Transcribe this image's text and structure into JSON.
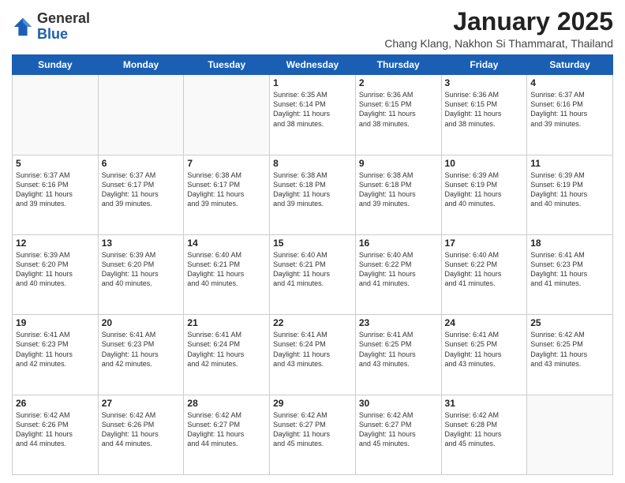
{
  "logo": {
    "general": "General",
    "blue": "Blue"
  },
  "title": "January 2025",
  "subtitle": "Chang Klang, Nakhon Si Thammarat, Thailand",
  "weekdays": [
    "Sunday",
    "Monday",
    "Tuesday",
    "Wednesday",
    "Thursday",
    "Friday",
    "Saturday"
  ],
  "weeks": [
    [
      {
        "day": "",
        "info": ""
      },
      {
        "day": "",
        "info": ""
      },
      {
        "day": "",
        "info": ""
      },
      {
        "day": "1",
        "info": "Sunrise: 6:35 AM\nSunset: 6:14 PM\nDaylight: 11 hours\nand 38 minutes."
      },
      {
        "day": "2",
        "info": "Sunrise: 6:36 AM\nSunset: 6:15 PM\nDaylight: 11 hours\nand 38 minutes."
      },
      {
        "day": "3",
        "info": "Sunrise: 6:36 AM\nSunset: 6:15 PM\nDaylight: 11 hours\nand 38 minutes."
      },
      {
        "day": "4",
        "info": "Sunrise: 6:37 AM\nSunset: 6:16 PM\nDaylight: 11 hours\nand 39 minutes."
      }
    ],
    [
      {
        "day": "5",
        "info": "Sunrise: 6:37 AM\nSunset: 6:16 PM\nDaylight: 11 hours\nand 39 minutes."
      },
      {
        "day": "6",
        "info": "Sunrise: 6:37 AM\nSunset: 6:17 PM\nDaylight: 11 hours\nand 39 minutes."
      },
      {
        "day": "7",
        "info": "Sunrise: 6:38 AM\nSunset: 6:17 PM\nDaylight: 11 hours\nand 39 minutes."
      },
      {
        "day": "8",
        "info": "Sunrise: 6:38 AM\nSunset: 6:18 PM\nDaylight: 11 hours\nand 39 minutes."
      },
      {
        "day": "9",
        "info": "Sunrise: 6:38 AM\nSunset: 6:18 PM\nDaylight: 11 hours\nand 39 minutes."
      },
      {
        "day": "10",
        "info": "Sunrise: 6:39 AM\nSunset: 6:19 PM\nDaylight: 11 hours\nand 40 minutes."
      },
      {
        "day": "11",
        "info": "Sunrise: 6:39 AM\nSunset: 6:19 PM\nDaylight: 11 hours\nand 40 minutes."
      }
    ],
    [
      {
        "day": "12",
        "info": "Sunrise: 6:39 AM\nSunset: 6:20 PM\nDaylight: 11 hours\nand 40 minutes."
      },
      {
        "day": "13",
        "info": "Sunrise: 6:39 AM\nSunset: 6:20 PM\nDaylight: 11 hours\nand 40 minutes."
      },
      {
        "day": "14",
        "info": "Sunrise: 6:40 AM\nSunset: 6:21 PM\nDaylight: 11 hours\nand 40 minutes."
      },
      {
        "day": "15",
        "info": "Sunrise: 6:40 AM\nSunset: 6:21 PM\nDaylight: 11 hours\nand 41 minutes."
      },
      {
        "day": "16",
        "info": "Sunrise: 6:40 AM\nSunset: 6:22 PM\nDaylight: 11 hours\nand 41 minutes."
      },
      {
        "day": "17",
        "info": "Sunrise: 6:40 AM\nSunset: 6:22 PM\nDaylight: 11 hours\nand 41 minutes."
      },
      {
        "day": "18",
        "info": "Sunrise: 6:41 AM\nSunset: 6:23 PM\nDaylight: 11 hours\nand 41 minutes."
      }
    ],
    [
      {
        "day": "19",
        "info": "Sunrise: 6:41 AM\nSunset: 6:23 PM\nDaylight: 11 hours\nand 42 minutes."
      },
      {
        "day": "20",
        "info": "Sunrise: 6:41 AM\nSunset: 6:23 PM\nDaylight: 11 hours\nand 42 minutes."
      },
      {
        "day": "21",
        "info": "Sunrise: 6:41 AM\nSunset: 6:24 PM\nDaylight: 11 hours\nand 42 minutes."
      },
      {
        "day": "22",
        "info": "Sunrise: 6:41 AM\nSunset: 6:24 PM\nDaylight: 11 hours\nand 43 minutes."
      },
      {
        "day": "23",
        "info": "Sunrise: 6:41 AM\nSunset: 6:25 PM\nDaylight: 11 hours\nand 43 minutes."
      },
      {
        "day": "24",
        "info": "Sunrise: 6:41 AM\nSunset: 6:25 PM\nDaylight: 11 hours\nand 43 minutes."
      },
      {
        "day": "25",
        "info": "Sunrise: 6:42 AM\nSunset: 6:25 PM\nDaylight: 11 hours\nand 43 minutes."
      }
    ],
    [
      {
        "day": "26",
        "info": "Sunrise: 6:42 AM\nSunset: 6:26 PM\nDaylight: 11 hours\nand 44 minutes."
      },
      {
        "day": "27",
        "info": "Sunrise: 6:42 AM\nSunset: 6:26 PM\nDaylight: 11 hours\nand 44 minutes."
      },
      {
        "day": "28",
        "info": "Sunrise: 6:42 AM\nSunset: 6:27 PM\nDaylight: 11 hours\nand 44 minutes."
      },
      {
        "day": "29",
        "info": "Sunrise: 6:42 AM\nSunset: 6:27 PM\nDaylight: 11 hours\nand 45 minutes."
      },
      {
        "day": "30",
        "info": "Sunrise: 6:42 AM\nSunset: 6:27 PM\nDaylight: 11 hours\nand 45 minutes."
      },
      {
        "day": "31",
        "info": "Sunrise: 6:42 AM\nSunset: 6:28 PM\nDaylight: 11 hours\nand 45 minutes."
      },
      {
        "day": "",
        "info": ""
      }
    ]
  ]
}
